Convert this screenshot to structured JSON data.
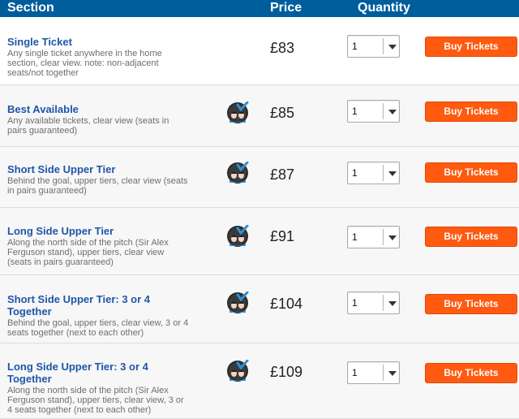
{
  "header": {
    "section": "Section",
    "price": "Price",
    "quantity": "Quantity"
  },
  "colors": {
    "header_bg": "#005d9b",
    "title": "#1f56a8",
    "button": "#ff5a10"
  },
  "rows": [
    {
      "title": [
        "Single Ticket"
      ],
      "desc": [
        "Any single ticket anywhere in the home",
        "section, clear view. note: non-adjacent",
        "seats/not together"
      ],
      "price": "£83",
      "quantity": "1",
      "button": "Buy Tickets",
      "badge": false
    },
    {
      "title": [
        "Best Available"
      ],
      "desc": [
        "Any available tickets, clear view (seats in",
        "pairs guaranteed)"
      ],
      "price": "£85",
      "quantity": "1",
      "button": "Buy Tickets",
      "badge": true
    },
    {
      "title": [
        "Short Side Upper Tier"
      ],
      "desc": [
        "Behind the goal, upper tiers, clear view (seats",
        "in pairs guaranteed)"
      ],
      "price": "£87",
      "quantity": "1",
      "button": "Buy Tickets",
      "badge": true
    },
    {
      "title": [
        "Long Side Upper Tier"
      ],
      "desc": [
        "Along the north side of the pitch (Sir Alex",
        "Ferguson stand), upper tiers, clear view",
        "(seats in pairs guaranteed)"
      ],
      "price": "£91",
      "quantity": "1",
      "button": "Buy Tickets",
      "badge": true
    },
    {
      "title": [
        "Short Side Upper Tier: 3 or 4",
        "Together"
      ],
      "desc": [
        "Behind the goal, upper tiers, clear view, 3 or 4",
        "seats together (next to each other)"
      ],
      "price": "£104",
      "quantity": "1",
      "button": "Buy Tickets",
      "badge": true
    },
    {
      "title": [
        "Long Side Upper Tier: 3 or 4",
        "Together"
      ],
      "desc": [
        "Along the north side of the pitch (Sir Alex",
        "Ferguson stand), upper tiers, clear view, 3 or",
        "4 seats together (next to each other)"
      ],
      "price": "£109",
      "quantity": "1",
      "button": "Buy Tickets",
      "badge": true
    }
  ]
}
